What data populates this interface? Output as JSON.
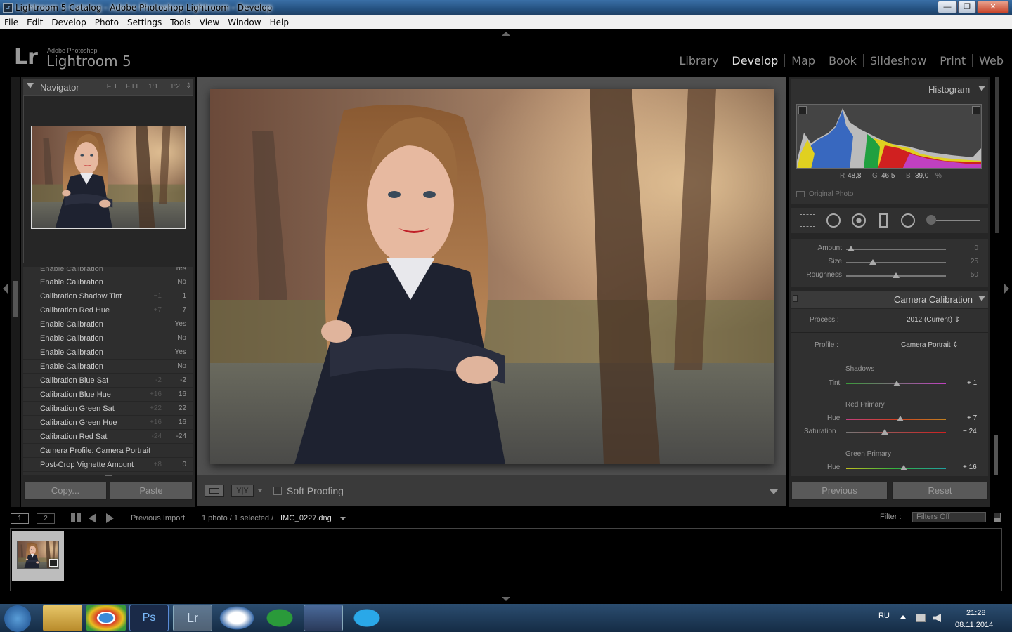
{
  "window": {
    "title": "Lightroom 5 Catalog - Adobe Photoshop Lightroom - Develop",
    "minimize": "—",
    "restore": "❐",
    "close": "✕"
  },
  "menu": [
    "File",
    "Edit",
    "Develop",
    "Photo",
    "Settings",
    "Tools",
    "View",
    "Window",
    "Help"
  ],
  "brand": {
    "logo": "Lr",
    "sub": "Adobe Photoshop",
    "name": "Lightroom 5"
  },
  "modules": [
    "Library",
    "Develop",
    "Map",
    "Book",
    "Slideshow",
    "Print",
    "Web"
  ],
  "navigator": {
    "title": "Navigator",
    "zoom": [
      "FIT",
      "FILL",
      "1:1",
      "1:2"
    ],
    "zoom_arrow": "⇕"
  },
  "history": {
    "partial": {
      "label": "Enable Calibration",
      "v2": "Yes"
    },
    "rows": [
      {
        "label": "Enable Calibration",
        "v1": "",
        "v2": "No"
      },
      {
        "label": "Calibration Shadow Tint",
        "v1": "−1",
        "v2": "1"
      },
      {
        "label": "Calibration Red Hue",
        "v1": "+7",
        "v2": "7"
      },
      {
        "label": "Enable Calibration",
        "v1": "",
        "v2": "Yes"
      },
      {
        "label": "Enable Calibration",
        "v1": "",
        "v2": "No"
      },
      {
        "label": "Enable Calibration",
        "v1": "",
        "v2": "Yes"
      },
      {
        "label": "Enable Calibration",
        "v1": "",
        "v2": "No"
      },
      {
        "label": "Calibration Blue Sat",
        "v1": "-2",
        "v2": "-2"
      },
      {
        "label": "Calibration Blue Hue",
        "v1": "+16",
        "v2": "16"
      },
      {
        "label": "Calibration Green Sat",
        "v1": "+22",
        "v2": "22"
      },
      {
        "label": "Calibration Green Hue",
        "v1": "+16",
        "v2": "16"
      },
      {
        "label": "Calibration Red Sat",
        "v1": "-24",
        "v2": "-24"
      },
      {
        "label": "Camera Profile: Camera Portrait",
        "v1": "",
        "v2": ""
      },
      {
        "label": "Post-Crop Vignette Amount",
        "v1": "+8",
        "v2": "0"
      }
    ]
  },
  "left_buttons": {
    "copy": "Copy...",
    "paste": "Paste"
  },
  "toolbar": {
    "soft_proofing": "Soft Proofing",
    "yy": "Y|Y"
  },
  "histogram": {
    "title": "Histogram",
    "r_label": "R",
    "r": "48,8",
    "g_label": "G",
    "g": "46,5",
    "b_label": "B",
    "b": "39,0",
    "pct": "%",
    "original": "Original Photo"
  },
  "effects": {
    "rows": [
      {
        "label": "Amount",
        "value": "0",
        "pos": 0.05
      },
      {
        "label": "Size",
        "value": "25",
        "pos": 0.27
      },
      {
        "label": "Roughness",
        "value": "50",
        "pos": 0.5
      }
    ]
  },
  "calibration": {
    "title": "Camera Calibration",
    "process_label": "Process :",
    "process": "2012 (Current) ⇕",
    "profile_label": "Profile :",
    "profile": "Camera Portrait ⇕",
    "shadows": "Shadows",
    "tint_label": "Tint",
    "tint": "+ 1",
    "tint_pos": 0.51,
    "red_primary": "Red Primary",
    "red_hue_label": "Hue",
    "red_hue": "+ 7",
    "red_hue_pos": 0.54,
    "red_sat_label": "Saturation",
    "red_sat": "− 24",
    "red_sat_pos": 0.39,
    "green_primary": "Green Primary",
    "green_hue_label": "Hue",
    "green_hue": "+ 16",
    "green_hue_pos": 0.58
  },
  "right_buttons": {
    "previous": "Previous",
    "reset": "Reset"
  },
  "filmbar": {
    "view1": "1",
    "view2": "2",
    "source": "Previous Import",
    "count": "1 photo / 1 selected /",
    "file": "IMG_0227.dng",
    "filter_label": "Filter :",
    "filter": "Filters Off"
  },
  "taskbar": {
    "lang": "RU",
    "time": "21:28",
    "date": "08.11.2014"
  }
}
